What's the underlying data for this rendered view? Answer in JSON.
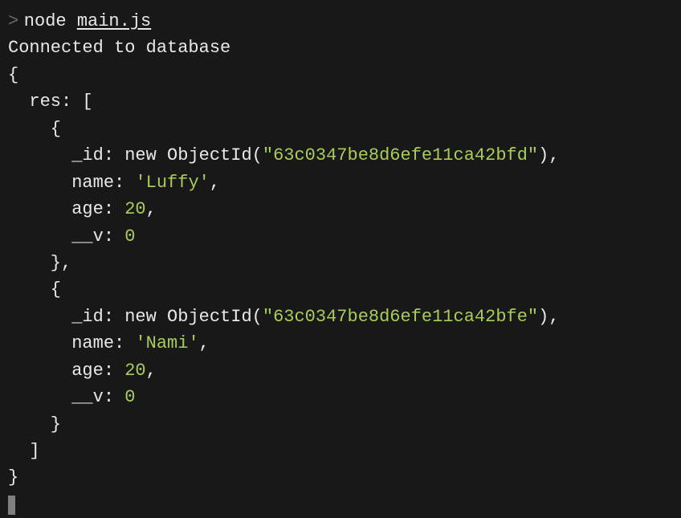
{
  "prompt": {
    "symbol": ">",
    "command": "node",
    "arg": "main.js"
  },
  "output": {
    "connected_msg": "Connected to database",
    "obj_open": "{",
    "res_label": "  res: [",
    "item_open_1": "    {",
    "record1": {
      "id_key": "      _id: ",
      "id_fn": "new ObjectId(",
      "id_val": "\"63c0347be8d6efe11ca42bfd\"",
      "id_close": "),",
      "name_key": "      name: ",
      "name_val": "'Luffy'",
      "name_after": ",",
      "age_key": "      age: ",
      "age_val": "20",
      "age_after": ",",
      "v_key": "      __v: ",
      "v_val": "0"
    },
    "item_close_1": "    },",
    "item_open_2": "    {",
    "record2": {
      "id_key": "      _id: ",
      "id_fn": "new ObjectId(",
      "id_val": "\"63c0347be8d6efe11ca42bfe\"",
      "id_close": "),",
      "name_key": "      name: ",
      "name_val": "'Nami'",
      "name_after": ",",
      "age_key": "      age: ",
      "age_val": "20",
      "age_after": ",",
      "v_key": "      __v: ",
      "v_val": "0"
    },
    "item_close_2": "    }",
    "arr_close": "  ]",
    "obj_close": "}"
  }
}
